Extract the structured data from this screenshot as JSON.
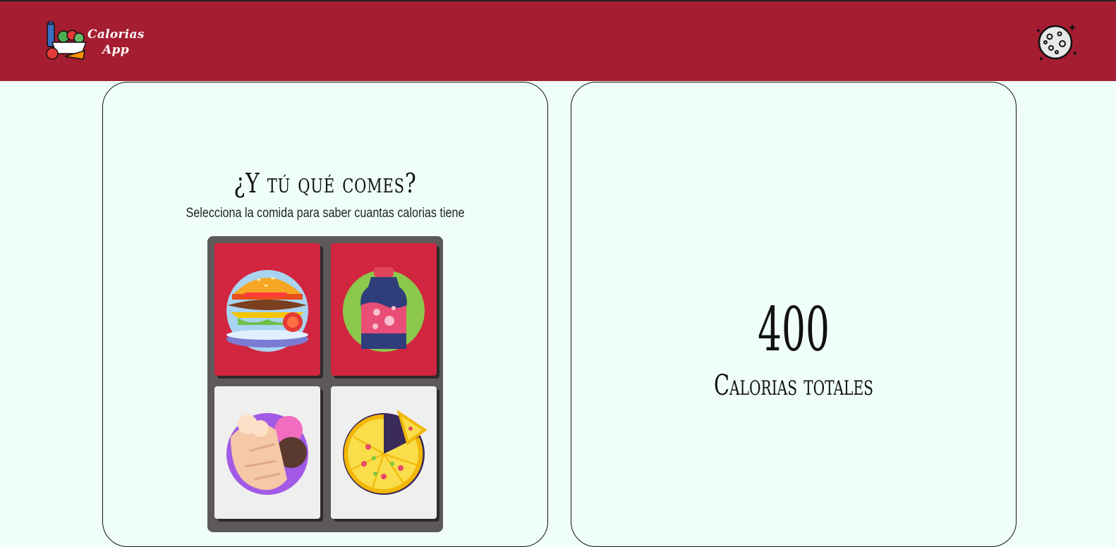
{
  "header": {
    "logo_text_line1": "Calorias",
    "logo_text_line2": "App",
    "logo_icon": "food-basket-icon",
    "theme_toggle_icon": "moon-icon",
    "background_color": "#a51d31"
  },
  "selector": {
    "title": "¿Y tú qué comes?",
    "subtitle": "Selecciona la comida para saber cuantas calorias tiene",
    "foods": [
      {
        "icon": "burger-icon",
        "selected": true
      },
      {
        "icon": "soda-bottle-icon",
        "selected": true
      },
      {
        "icon": "ice-cream-icon",
        "selected": false
      },
      {
        "icon": "pizza-icon",
        "selected": false
      }
    ]
  },
  "total": {
    "value": "400",
    "label": "Calorias totales"
  },
  "colors": {
    "page_background": "#effff8",
    "selected_tile": "#d12540",
    "unselected_tile": "#efefef",
    "grid_background": "#5e5959"
  }
}
